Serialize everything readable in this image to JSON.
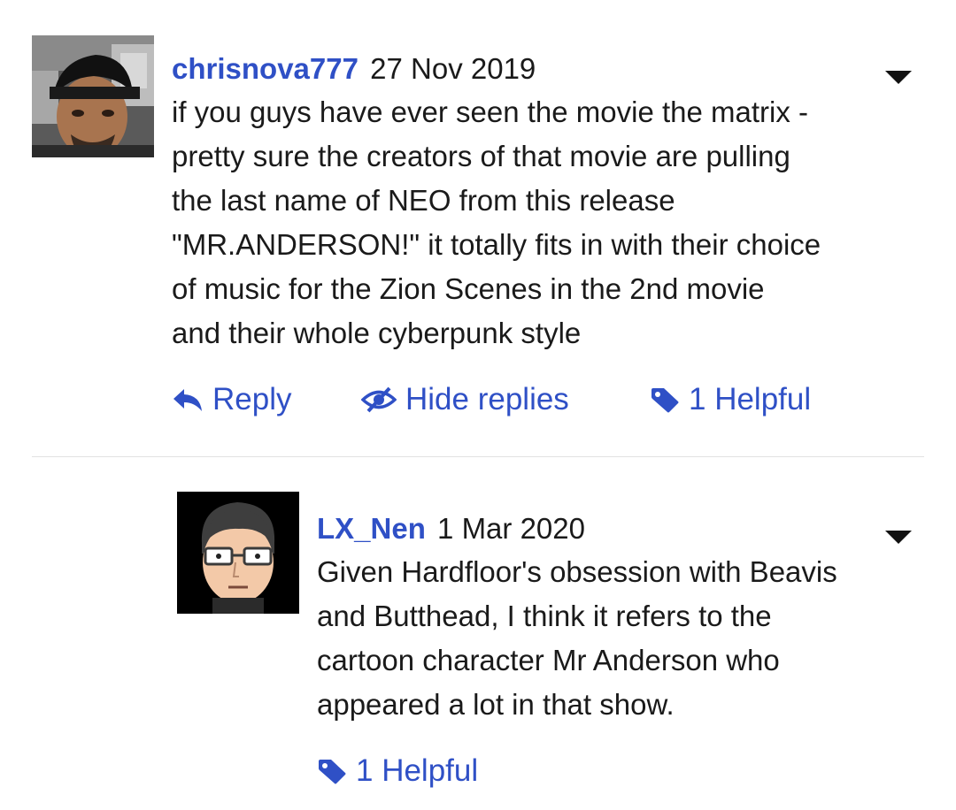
{
  "comments": [
    {
      "username": "chrisnova777",
      "date": "27 Nov 2019",
      "lines": [
        "if you guys have ever seen the movie the matrix -",
        "pretty sure the creators of that movie are pulling",
        "the last name of NEO from this release",
        "\"MR.ANDERSON!\" it totally fits in with their choice",
        "of music for the Zion Scenes in the 2nd movie",
        "and their whole cyberpunk style"
      ],
      "actions": {
        "reply": "Reply",
        "hide_replies": "Hide replies",
        "helpful": "1 Helpful"
      }
    },
    {
      "username": "LX_Nen",
      "date": "1 Mar 2020",
      "lines": [
        "Given Hardfloor's obsession with Beavis",
        "and Butthead, I think it refers to the",
        "cartoon character Mr Anderson who",
        "appeared a lot in that show."
      ],
      "actions": {
        "helpful": "1 Helpful"
      }
    }
  ],
  "icons": {
    "reply": "reply-arrow-icon",
    "hide": "eye-slash-icon",
    "helpful": "tag-icon",
    "menu": "caret-down-icon"
  },
  "colors": {
    "accent": "#2f50c6",
    "text": "#1a1a1a",
    "divider": "#e2e2e2"
  }
}
